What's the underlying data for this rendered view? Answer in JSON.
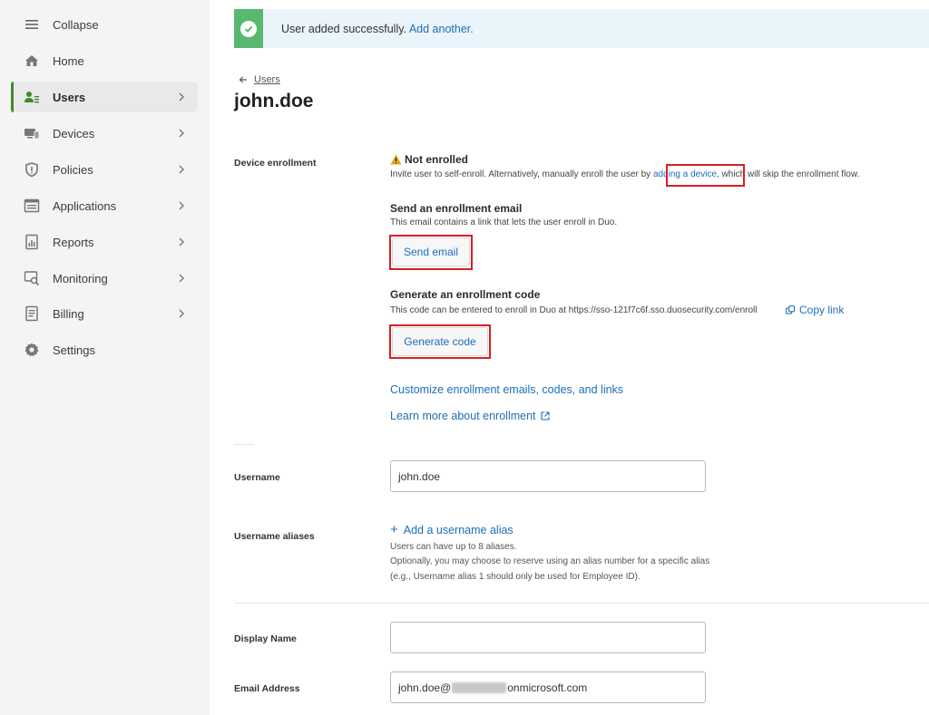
{
  "sidebar": {
    "items": [
      {
        "label": "Collapse",
        "icon": "hamburger-icon"
      },
      {
        "label": "Home",
        "icon": "home-icon"
      },
      {
        "label": "Users",
        "icon": "users-icon",
        "active": true
      },
      {
        "label": "Devices",
        "icon": "devices-icon"
      },
      {
        "label": "Policies",
        "icon": "shield-icon"
      },
      {
        "label": "Applications",
        "icon": "applications-icon"
      },
      {
        "label": "Reports",
        "icon": "reports-icon"
      },
      {
        "label": "Monitoring",
        "icon": "monitoring-icon"
      },
      {
        "label": "Billing",
        "icon": "billing-icon"
      },
      {
        "label": "Settings",
        "icon": "gear-icon"
      }
    ]
  },
  "banner": {
    "message": "User added successfully.",
    "link": "Add another."
  },
  "breadcrumb": {
    "parent": "Users"
  },
  "page_title": "john.doe",
  "enrollment": {
    "label": "Device enrollment",
    "status": "Not enrolled",
    "status_desc_before": "Invite user to self-enroll. Alternatively, manually enroll the user by ",
    "status_desc_link": "adding a device",
    "status_desc_after": ", which will skip the enrollment flow.",
    "email_title": "Send an enrollment email",
    "email_desc": "This email contains a link that lets the user enroll in Duo.",
    "email_button": "Send email",
    "code_title": "Generate an enrollment code",
    "code_desc": "This code can be entered to enroll in Duo at https://sso-121f7c6f.sso.duosecurity.com/enroll",
    "copy_link": "Copy link",
    "code_button": "Generate code",
    "customize_link": "Customize enrollment emails, codes, and links",
    "learn_link": "Learn more about enrollment"
  },
  "username": {
    "label": "Username",
    "value": "john.doe"
  },
  "aliases": {
    "label": "Username aliases",
    "add_link": "Add a username alias",
    "note1": "Users can have up to 8 aliases.",
    "note2": "Optionally, you may choose to reserve using an alias number for a specific alias",
    "note3": "(e.g., Username alias 1 should only be used for Employee ID)."
  },
  "display_name": {
    "label": "Display Name",
    "value": ""
  },
  "email": {
    "label": "Email Address",
    "value_prefix": "john.doe@",
    "value_suffix": "onmicrosoft.com"
  },
  "colors": {
    "accent": "#1c6fb8",
    "success": "#58b870",
    "highlight": "#d61f26",
    "active_nav": "#3f8a2b"
  }
}
